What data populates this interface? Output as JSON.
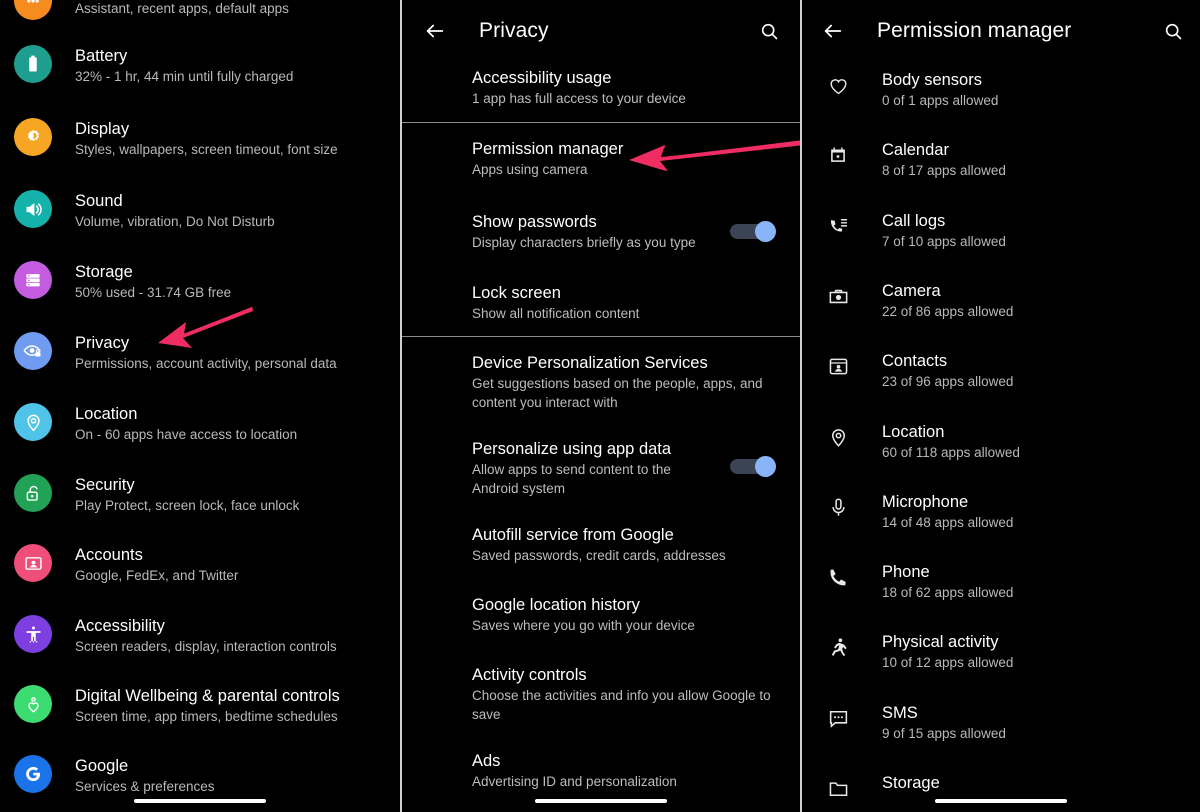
{
  "colors": {
    "background": "#000000",
    "title_text": "#ffffff",
    "subtitle_text": "#b9b9b9",
    "divider": "#8a8a8a",
    "toggle_on_knob": "#8ab4f8",
    "toggle_on_track": "#3b4455",
    "annotation_arrow": "#ef2d63",
    "icon_assistant": "#f68b1f",
    "icon_battery": "#1f9e8f",
    "icon_display": "#f6a623",
    "icon_sound": "#15b2ab",
    "icon_storage": "#c45ce0",
    "icon_privacy": "#6f9cf0",
    "icon_location": "#4fc3e8",
    "icon_security": "#22a257",
    "icon_accounts": "#ef4d7a",
    "icon_accessibility": "#7d3fe0",
    "icon_wellbeing": "#3ddc72",
    "icon_google": "#1a73e8"
  },
  "settings_panel": {
    "name": "Settings",
    "items": [
      {
        "icon": "assistant-icon",
        "icon_color": "#f68b1f",
        "title": "",
        "subtitle": "Assistant, recent apps, default apps",
        "partial": true
      },
      {
        "icon": "battery-icon",
        "icon_color": "#1f9e8f",
        "title": "Battery",
        "subtitle": "32% - 1 hr, 44 min until fully charged"
      },
      {
        "icon": "display-icon",
        "icon_color": "#f6a623",
        "title": "Display",
        "subtitle": "Styles, wallpapers, screen timeout, font size"
      },
      {
        "icon": "sound-icon",
        "icon_color": "#15b2ab",
        "title": "Sound",
        "subtitle": "Volume, vibration, Do Not Disturb"
      },
      {
        "icon": "storage-icon",
        "icon_color": "#c45ce0",
        "title": "Storage",
        "subtitle": "50% used - 31.74 GB free"
      },
      {
        "icon": "privacy-eye-lock-icon",
        "icon_color": "#6f9cf0",
        "title": "Privacy",
        "subtitle": "Permissions, account activity, personal data",
        "annotated": true
      },
      {
        "icon": "location-pin-icon",
        "icon_color": "#4fc3e8",
        "title": "Location",
        "subtitle": "On - 60 apps have access to location"
      },
      {
        "icon": "security-lock-icon",
        "icon_color": "#22a257",
        "title": "Security",
        "subtitle": "Play Protect, screen lock, face unlock"
      },
      {
        "icon": "accounts-person-icon",
        "icon_color": "#ef4d7a",
        "title": "Accounts",
        "subtitle": "Google, FedEx, and Twitter"
      },
      {
        "icon": "accessibility-icon",
        "icon_color": "#7d3fe0",
        "title": "Accessibility",
        "subtitle": "Screen readers, display, interaction controls"
      },
      {
        "icon": "digital-wellbeing-heart-icon",
        "icon_color": "#3ddc72",
        "title": "Digital Wellbeing & parental controls",
        "subtitle": "Screen time, app timers, bedtime schedules"
      },
      {
        "icon": "google-g-icon",
        "icon_color": "#1a73e8",
        "title": "Google",
        "subtitle": "Services & preferences"
      }
    ]
  },
  "privacy_panel": {
    "appbar": {
      "back_icon": "back-arrow-icon",
      "title": "Privacy",
      "search_icon": "search-icon"
    },
    "groups": [
      {
        "items": [
          {
            "title": "Accessibility usage",
            "subtitle": "1 app has full access to your device",
            "toggle": null
          }
        ]
      },
      {
        "items": [
          {
            "title": "Permission manager",
            "subtitle": "Apps using camera",
            "toggle": null,
            "annotated": true
          },
          {
            "title": "Show passwords",
            "subtitle": "Display characters briefly as you type",
            "toggle": "on"
          },
          {
            "title": "Lock screen",
            "subtitle": "Show all notification content",
            "toggle": null
          }
        ]
      },
      {
        "items": [
          {
            "title": "Device Personalization Services",
            "subtitle": "Get suggestions based on the people, apps, and content you interact with",
            "toggle": null
          },
          {
            "title": "Personalize using app data",
            "subtitle": "Allow apps to send content to the Android system",
            "toggle": "on"
          },
          {
            "title": "Autofill service from Google",
            "subtitle": "Saved passwords, credit cards, addresses",
            "toggle": null
          },
          {
            "title": "Google location history",
            "subtitle": "Saves where you go with your device",
            "toggle": null
          },
          {
            "title": "Activity controls",
            "subtitle": "Choose the activities and info you allow Google to save",
            "toggle": null
          },
          {
            "title": "Ads",
            "subtitle": "Advertising ID and personalization",
            "toggle": null
          }
        ]
      }
    ]
  },
  "permission_panel": {
    "appbar": {
      "back_icon": "back-arrow-icon",
      "title": "Permission manager",
      "search_icon": "search-icon"
    },
    "items": [
      {
        "icon": "body-sensors-heart-icon",
        "title": "Body sensors",
        "subtitle": "0 of 1 apps allowed"
      },
      {
        "icon": "calendar-icon",
        "title": "Calendar",
        "subtitle": "8 of 17 apps allowed"
      },
      {
        "icon": "call-logs-icon",
        "title": "Call logs",
        "subtitle": "7 of 10 apps allowed"
      },
      {
        "icon": "camera-icon",
        "title": "Camera",
        "subtitle": "22 of 86 apps allowed"
      },
      {
        "icon": "contacts-icon",
        "title": "Contacts",
        "subtitle": "23 of 96 apps allowed"
      },
      {
        "icon": "location-pin-icon",
        "title": "Location",
        "subtitle": "60 of 118 apps allowed"
      },
      {
        "icon": "microphone-icon",
        "title": "Microphone",
        "subtitle": "14 of 48 apps allowed"
      },
      {
        "icon": "phone-icon",
        "title": "Phone",
        "subtitle": "18 of 62 apps allowed"
      },
      {
        "icon": "physical-activity-icon",
        "title": "Physical activity",
        "subtitle": "10 of 12 apps allowed"
      },
      {
        "icon": "sms-icon",
        "title": "SMS",
        "subtitle": "9 of 15 apps allowed"
      },
      {
        "icon": "storage-folder-icon",
        "title": "Storage",
        "subtitle": ""
      }
    ]
  }
}
